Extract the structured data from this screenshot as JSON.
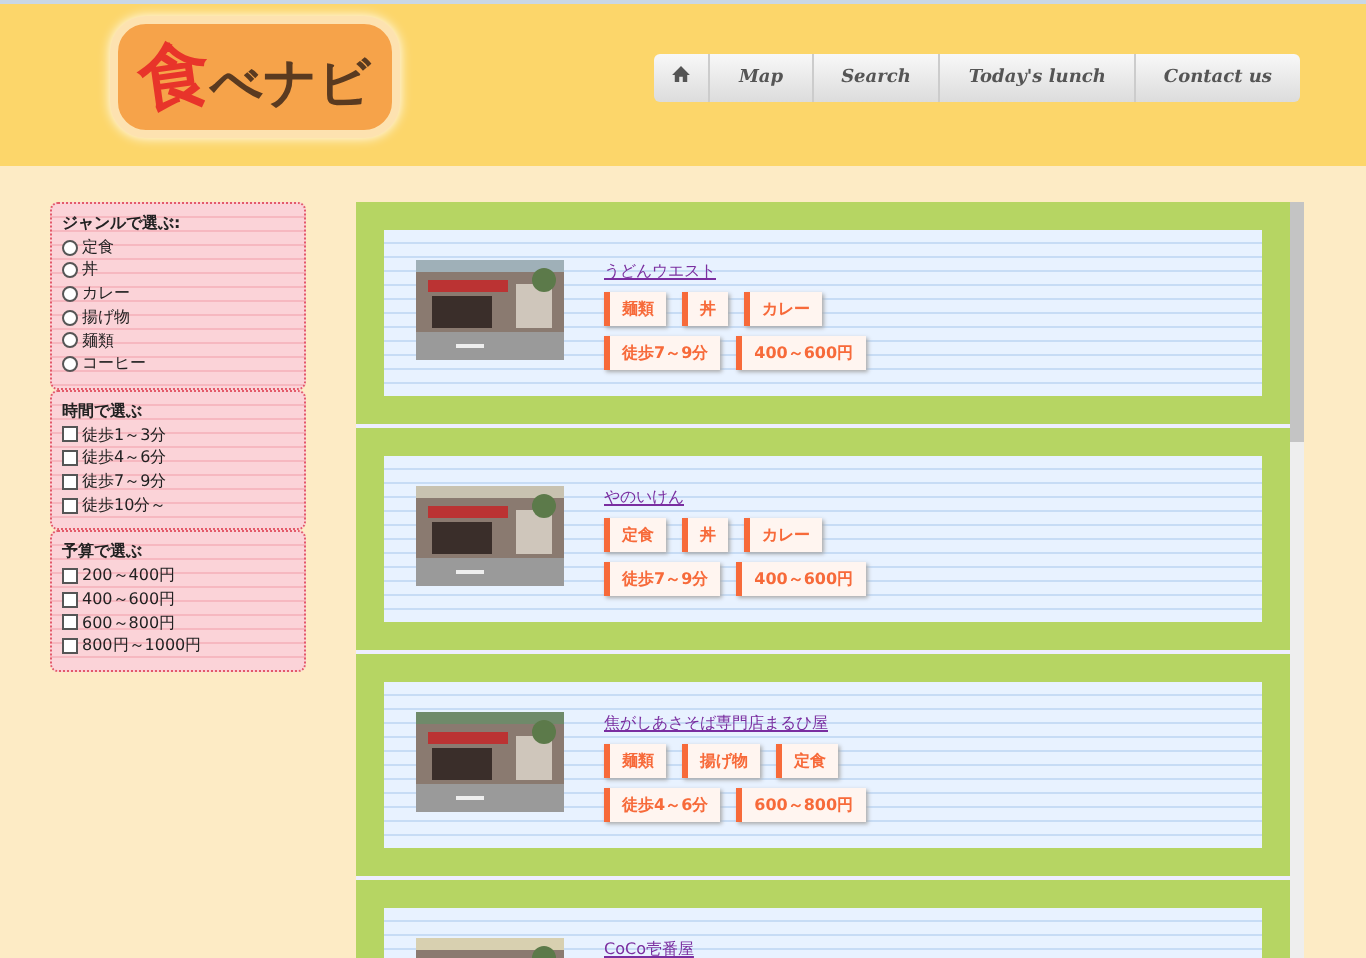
{
  "logo": {
    "first": "食",
    "rest": "べナビ"
  },
  "nav": [
    {
      "kind": "home"
    },
    {
      "kind": "text",
      "label": "Map"
    },
    {
      "kind": "text",
      "label": "Search"
    },
    {
      "kind": "text",
      "label": "Today's lunch"
    },
    {
      "kind": "text",
      "label": "Contact us"
    }
  ],
  "filters": [
    {
      "title": "ジャンルで選ぶ:",
      "kind": "radio",
      "options": [
        {
          "label": "定食",
          "selected": false
        },
        {
          "label": "丼",
          "selected": false
        },
        {
          "label": "カレー",
          "selected": false
        },
        {
          "label": "揚げ物",
          "selected": false
        },
        {
          "label": "麺類",
          "selected": false
        },
        {
          "label": "コーヒー",
          "selected": false
        }
      ]
    },
    {
      "title": "時間で選ぶ",
      "kind": "checkbox",
      "options": [
        {
          "label": "徒歩1～3分",
          "checked": false
        },
        {
          "label": "徒歩4～6分",
          "checked": false
        },
        {
          "label": "徒歩7～9分",
          "checked": false
        },
        {
          "label": "徒歩10分～",
          "checked": false
        }
      ]
    },
    {
      "title": "予算で選ぶ",
      "kind": "checkbox",
      "options": [
        {
          "label": "200～400円",
          "checked": false
        },
        {
          "label": "400～600円",
          "checked": false
        },
        {
          "label": "600～800円",
          "checked": false
        },
        {
          "label": "800円～1000円",
          "checked": false
        }
      ]
    }
  ],
  "restaurants": [
    {
      "name": "うどんウエスト",
      "genres": [
        "麺類",
        "丼",
        "カレー"
      ],
      "walk": "徒歩7～9分",
      "price": "400～600円"
    },
    {
      "name": "やのいけん",
      "genres": [
        "定食",
        "丼",
        "カレー"
      ],
      "walk": "徒歩7～9分",
      "price": "400～600円"
    },
    {
      "name": "焦がしあさそば専門店まるひ屋",
      "genres": [
        "麺類",
        "揚げ物",
        "定食"
      ],
      "walk": "徒歩4～6分",
      "price": "600～800円"
    },
    {
      "name": "CoCo壱番屋"
    }
  ]
}
